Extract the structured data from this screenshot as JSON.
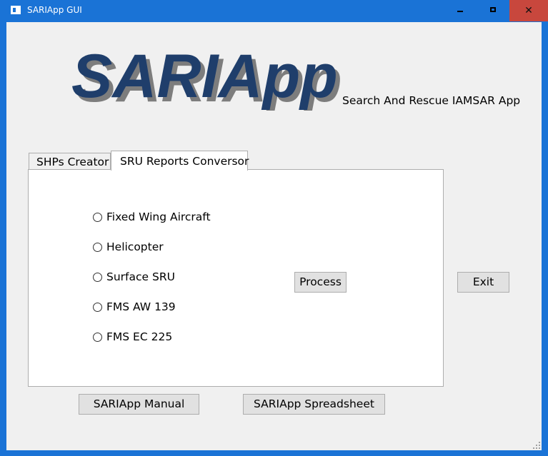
{
  "window": {
    "title": "SARIApp GUI",
    "controls": {
      "minimize_icon": "minimize-icon",
      "maximize_icon": "maximize-icon",
      "close_icon": "close-icon",
      "close_glyph": "✕"
    },
    "titlebar_color": "#1a73d6",
    "close_color": "#c8473d"
  },
  "header": {
    "logo_text": "SARIApp",
    "logo_color": "#1f3e6b",
    "subtitle": "Search And Rescue IAMSAR App"
  },
  "tabs": [
    {
      "label": "SHPs Creator",
      "selected": false
    },
    {
      "label": "SRU Reports Conversor",
      "selected": true
    }
  ],
  "sru_panel": {
    "options": [
      {
        "label": "Fixed Wing Aircraft",
        "checked": false
      },
      {
        "label": "Helicopter",
        "checked": false
      },
      {
        "label": "Surface SRU",
        "checked": false
      },
      {
        "label": "FMS AW 139",
        "checked": false
      },
      {
        "label": "FMS EC 225",
        "checked": false
      }
    ],
    "process_label": "Process"
  },
  "buttons": {
    "exit_label": "Exit",
    "manual_label": "SARIApp Manual",
    "spreadsheet_label": "SARIApp Spreadsheet"
  }
}
